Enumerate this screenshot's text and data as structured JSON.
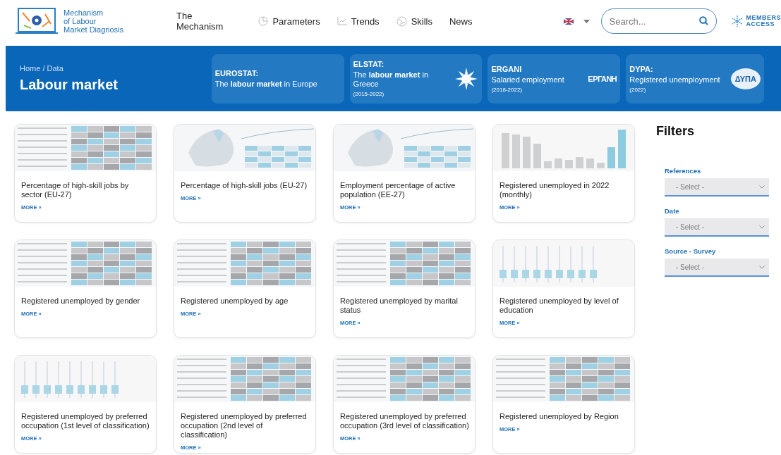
{
  "logo": {
    "lines": [
      "Mechanism",
      "of Labour",
      "Market Diagnosis"
    ]
  },
  "nav": [
    {
      "label": "The Mechanism",
      "kind": "plain"
    },
    {
      "label": "Parameters",
      "kind": "pie"
    },
    {
      "label": "Trends",
      "kind": "trend"
    },
    {
      "label": "Skills",
      "kind": "globe"
    },
    {
      "label": "News",
      "kind": "plain"
    }
  ],
  "search": {
    "placeholder": "Search..."
  },
  "members": {
    "lines": [
      "MEMBERS",
      "ACCESS"
    ]
  },
  "banner": {
    "breadcrumb": "Home / Data",
    "title": "Labour market",
    "sources": [
      {
        "name": "EUROSTAT:",
        "text": "The **labour market** in Europe",
        "kind": "plain"
      },
      {
        "name": "ELSTAT:",
        "text": "The **labour market** in Greece",
        "years": "(2015-2022)",
        "kind": "sun"
      },
      {
        "name": "ERGANI",
        "text": "Salaried employment",
        "years": "(2018-2022)",
        "kind": "ergani",
        "logo_text": "ΕΡΓΑΝΗ"
      },
      {
        "name": "DYPA:",
        "text": "Registered unemployment",
        "years": "(2022)",
        "kind": "dypa",
        "logo_text": "ΔΥΠΑ"
      }
    ]
  },
  "cards": [
    {
      "title": "Percentage of high-skill jobs by sector (EU-27)",
      "more": "MORE »",
      "kind": "table"
    },
    {
      "title": "Percentage of high-skill jobs (EU-27)",
      "more": "MORE »",
      "kind": "map"
    },
    {
      "title": "Employment percentage of active population (EE-27)",
      "more": "MORE »",
      "kind": "map"
    },
    {
      "title": "Registered unemployed in 2022 (monthly)",
      "more": "MORE »",
      "kind": "bars"
    },
    {
      "title": "Registered unemployed by gender",
      "more": "MORE »",
      "kind": "table"
    },
    {
      "title": "Registered unemployed by age",
      "more": "MORE »",
      "kind": "table"
    },
    {
      "title": "Registered unemployed by marital status",
      "more": "MORE »",
      "kind": "table"
    },
    {
      "title": "Registered unemployed by level of education",
      "more": "MORE »",
      "kind": "boxes"
    },
    {
      "title": "Registered unemployed by preferred occupation (1st level of classification)",
      "more": "MORE »",
      "kind": "boxes"
    },
    {
      "title": "Registered unemployed by preferred occupation (2nd level of classification)",
      "more": "MORE »",
      "kind": "table"
    },
    {
      "title": "Registered unemployed by preferred occupation (3rd level of classification)",
      "more": "MORE »",
      "kind": "table"
    },
    {
      "title": "Registered unemployed by Region",
      "more": "MORE »",
      "kind": "table"
    }
  ],
  "filters": {
    "title": "Filters",
    "fields": [
      {
        "label": "References",
        "placeholder": "- Select -"
      },
      {
        "label": "Date",
        "placeholder": "- Select -"
      },
      {
        "label": "Source - Survey",
        "placeholder": "- Select -"
      }
    ]
  }
}
